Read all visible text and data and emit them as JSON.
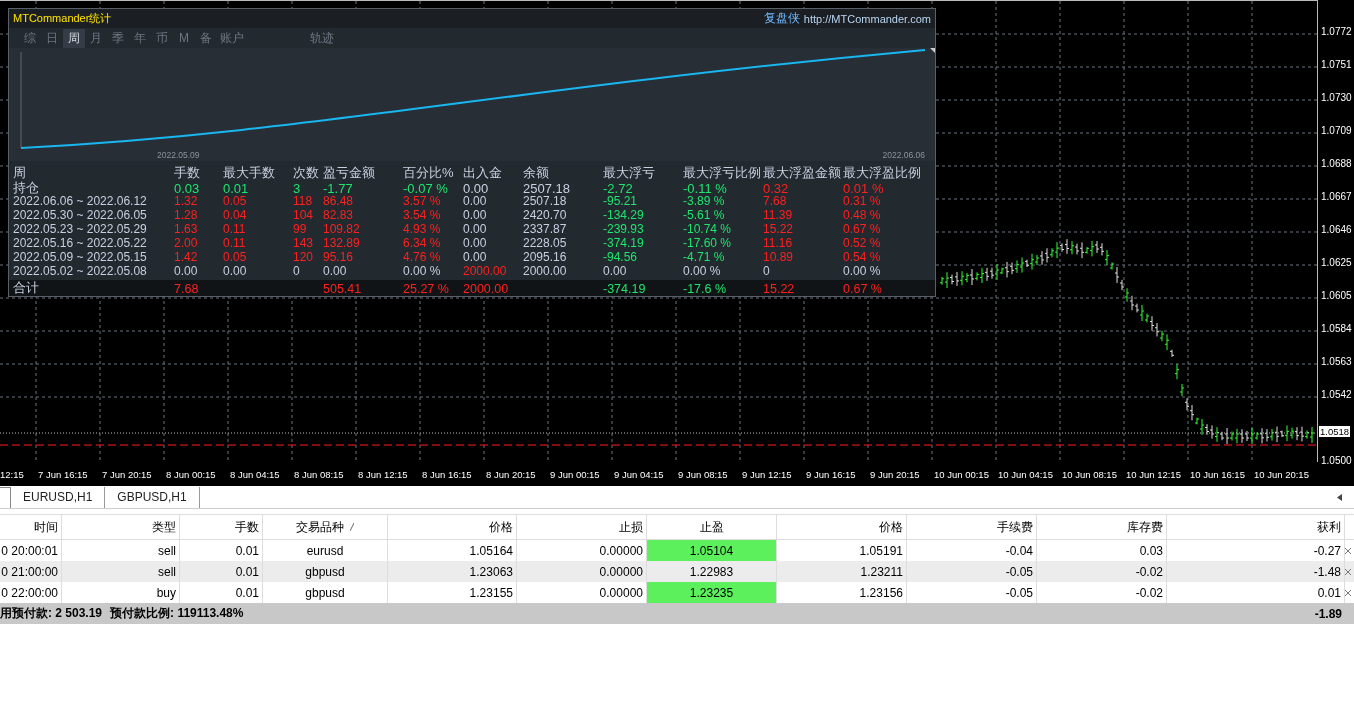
{
  "chart": {
    "price_labels": [
      "1.0772",
      "1.0751",
      "1.0730",
      "1.0709",
      "1.0688",
      "1.0667",
      "1.0646",
      "1.0625",
      "1.0605",
      "1.0584",
      "1.0563",
      "1.0542",
      "1.0500"
    ],
    "current_price": "1.0518",
    "time_labels": [
      "12:15",
      "7 Jun 16:15",
      "7 Jun 20:15",
      "8 Jun 00:15",
      "8 Jun 04:15",
      "8 Jun 08:15",
      "8 Jun 12:15",
      "8 Jun 16:15",
      "8 Jun 20:15",
      "9 Jun 00:15",
      "9 Jun 04:15",
      "9 Jun 08:15",
      "9 Jun 12:15",
      "9 Jun 16:15",
      "9 Jun 20:15",
      "10 Jun 00:15",
      "10 Jun 04:15",
      "10 Jun 08:15",
      "10 Jun 12:15",
      "10 Jun 16:15",
      "10 Jun 20:15"
    ]
  },
  "panel": {
    "title": "MTCommander统计",
    "brand": "复盘侠",
    "link": "http://MTCommander.com",
    "tabs": [
      {
        "label": "综",
        "selected": false
      },
      {
        "label": "日",
        "selected": false
      },
      {
        "label": "周",
        "selected": true
      },
      {
        "label": "月",
        "selected": false
      },
      {
        "label": "季",
        "selected": false
      },
      {
        "label": "年",
        "selected": false
      },
      {
        "label": "币",
        "selected": false
      },
      {
        "label": "M",
        "selected": false
      },
      {
        "label": "备",
        "selected": false
      },
      {
        "label": "账户",
        "selected": false
      },
      {
        "label": "轨迹",
        "selected": false
      }
    ],
    "equity_dates": [
      "2022.05.09",
      "2022.06.06"
    ],
    "columns": [
      "周",
      "手数",
      "最大手数",
      "次数",
      "盈亏金额",
      "百分比%",
      "出入金",
      "余额",
      "最大浮亏",
      "最大浮亏比例",
      "最大浮盈金额",
      "最大浮盈比例"
    ],
    "rows": [
      {
        "kind": "open",
        "cells": [
          {
            "text": "持仓",
            "color": "#c8d0e0"
          },
          {
            "text": "0.03",
            "color": "#1ee66e"
          },
          {
            "text": "0.01",
            "color": "#1ee66e"
          },
          {
            "text": "3",
            "color": "#1ee66e"
          },
          {
            "text": "-1.77",
            "color": "#1ee66e"
          },
          {
            "text": "-0.07 %",
            "color": "#1ee66e"
          },
          {
            "text": "0.00",
            "color": "#c8d0e0"
          },
          {
            "text": "2507.18",
            "color": "#c8d0e0"
          },
          {
            "text": "-2.72",
            "color": "#1ee66e"
          },
          {
            "text": "-0.11 %",
            "color": "#1ee66e"
          },
          {
            "text": "0.32",
            "color": "#ff2020"
          },
          {
            "text": "0.01 %",
            "color": "#ff2020"
          }
        ]
      },
      {
        "kind": "week",
        "cells": [
          {
            "text": "2022.06.06 ~ 2022.06.12",
            "color": "#c8d0e0"
          },
          {
            "text": "1.32",
            "color": "#ff2020"
          },
          {
            "text": "0.05",
            "color": "#ff2020"
          },
          {
            "text": "118",
            "color": "#ff2020"
          },
          {
            "text": "86.48",
            "color": "#ff2020"
          },
          {
            "text": "3.57 %",
            "color": "#ff2020"
          },
          {
            "text": "0.00",
            "color": "#c8d0e0"
          },
          {
            "text": "2507.18",
            "color": "#c8d0e0"
          },
          {
            "text": "-95.21",
            "color": "#1ee66e"
          },
          {
            "text": "-3.89 %",
            "color": "#1ee66e"
          },
          {
            "text": "7.68",
            "color": "#ff2020"
          },
          {
            "text": "0.31 %",
            "color": "#ff2020"
          }
        ]
      },
      {
        "kind": "week",
        "cells": [
          {
            "text": "2022.05.30 ~ 2022.06.05",
            "color": "#c8d0e0"
          },
          {
            "text": "1.28",
            "color": "#ff2020"
          },
          {
            "text": "0.04",
            "color": "#ff2020"
          },
          {
            "text": "104",
            "color": "#ff2020"
          },
          {
            "text": "82.83",
            "color": "#ff2020"
          },
          {
            "text": "3.54 %",
            "color": "#ff2020"
          },
          {
            "text": "0.00",
            "color": "#c8d0e0"
          },
          {
            "text": "2420.70",
            "color": "#c8d0e0"
          },
          {
            "text": "-134.29",
            "color": "#1ee66e"
          },
          {
            "text": "-5.61 %",
            "color": "#1ee66e"
          },
          {
            "text": "11.39",
            "color": "#ff2020"
          },
          {
            "text": "0.48 %",
            "color": "#ff2020"
          }
        ]
      },
      {
        "kind": "week",
        "cells": [
          {
            "text": "2022.05.23 ~ 2022.05.29",
            "color": "#c8d0e0"
          },
          {
            "text": "1.63",
            "color": "#ff2020"
          },
          {
            "text": "0.11",
            "color": "#ff2020"
          },
          {
            "text": "99",
            "color": "#ff2020"
          },
          {
            "text": "109.82",
            "color": "#ff2020"
          },
          {
            "text": "4.93 %",
            "color": "#ff2020"
          },
          {
            "text": "0.00",
            "color": "#c8d0e0"
          },
          {
            "text": "2337.87",
            "color": "#c8d0e0"
          },
          {
            "text": "-239.93",
            "color": "#1ee66e"
          },
          {
            "text": "-10.74 %",
            "color": "#1ee66e"
          },
          {
            "text": "15.22",
            "color": "#ff2020"
          },
          {
            "text": "0.67 %",
            "color": "#ff2020"
          }
        ]
      },
      {
        "kind": "week",
        "cells": [
          {
            "text": "2022.05.16 ~ 2022.05.22",
            "color": "#c8d0e0"
          },
          {
            "text": "2.00",
            "color": "#ff2020"
          },
          {
            "text": "0.11",
            "color": "#ff2020"
          },
          {
            "text": "143",
            "color": "#ff2020"
          },
          {
            "text": "132.89",
            "color": "#ff2020"
          },
          {
            "text": "6.34 %",
            "color": "#ff2020"
          },
          {
            "text": "0.00",
            "color": "#c8d0e0"
          },
          {
            "text": "2228.05",
            "color": "#c8d0e0"
          },
          {
            "text": "-374.19",
            "color": "#1ee66e"
          },
          {
            "text": "-17.60 %",
            "color": "#1ee66e"
          },
          {
            "text": "11.16",
            "color": "#ff2020"
          },
          {
            "text": "0.52 %",
            "color": "#ff2020"
          }
        ]
      },
      {
        "kind": "week",
        "cells": [
          {
            "text": "2022.05.09 ~ 2022.05.15",
            "color": "#c8d0e0"
          },
          {
            "text": "1.42",
            "color": "#ff2020"
          },
          {
            "text": "0.05",
            "color": "#ff2020"
          },
          {
            "text": "120",
            "color": "#ff2020"
          },
          {
            "text": "95.16",
            "color": "#ff2020"
          },
          {
            "text": "4.76 %",
            "color": "#ff2020"
          },
          {
            "text": "0.00",
            "color": "#c8d0e0"
          },
          {
            "text": "2095.16",
            "color": "#c8d0e0"
          },
          {
            "text": "-94.56",
            "color": "#1ee66e"
          },
          {
            "text": "-4.71 %",
            "color": "#1ee66e"
          },
          {
            "text": "10.89",
            "color": "#ff2020"
          },
          {
            "text": "0.54 %",
            "color": "#ff2020"
          }
        ]
      },
      {
        "kind": "week",
        "cells": [
          {
            "text": "2022.05.02 ~ 2022.05.08",
            "color": "#c8d0e0"
          },
          {
            "text": "0.00",
            "color": "#c8d0e0"
          },
          {
            "text": "0.00",
            "color": "#c8d0e0"
          },
          {
            "text": "0",
            "color": "#c8d0e0"
          },
          {
            "text": "0.00",
            "color": "#c8d0e0"
          },
          {
            "text": "0.00 %",
            "color": "#c8d0e0"
          },
          {
            "text": "2000.00",
            "color": "#ff2020"
          },
          {
            "text": "2000.00",
            "color": "#c8d0e0"
          },
          {
            "text": "0.00",
            "color": "#c8d0e0"
          },
          {
            "text": "0.00 %",
            "color": "#c8d0e0"
          },
          {
            "text": "0",
            "color": "#c8d0e0"
          },
          {
            "text": "0.00 %",
            "color": "#c8d0e0"
          }
        ]
      },
      {
        "kind": "total",
        "cells": [
          {
            "text": "合计",
            "color": "#c8d0e0"
          },
          {
            "text": "7.68",
            "color": "#ff2020"
          },
          null,
          null,
          {
            "text": "505.41",
            "color": "#ff2020"
          },
          {
            "text": "25.27 %",
            "color": "#ff2020"
          },
          {
            "text": "2000.00",
            "color": "#ff2020"
          },
          null,
          {
            "text": "-374.19",
            "color": "#1ee66e"
          },
          {
            "text": "-17.6 %",
            "color": "#1ee66e"
          },
          {
            "text": "15.22",
            "color": "#ff2020"
          },
          {
            "text": "0.67 %",
            "color": "#ff2020"
          }
        ]
      }
    ]
  },
  "chart_tabs": [
    {
      "label": "EURUSD,H1",
      "selected": false
    },
    {
      "label": "GBPUSD,H1",
      "selected": false
    }
  ],
  "orders": {
    "columns": [
      "时间",
      "类型",
      "手数",
      "交易品种",
      "价格",
      "止损",
      "止盈",
      "价格",
      "手续费",
      "库存费",
      "获利"
    ],
    "rows": [
      {
        "cells": [
          "0 20:00:01",
          "sell",
          "0.01",
          "eurusd",
          "1.05164",
          "0.00000",
          "1.05104",
          "1.05191",
          "-0.04",
          "0.03",
          "-0.27"
        ],
        "tp_highlight": true
      },
      {
        "cells": [
          "0 21:00:00",
          "sell",
          "0.01",
          "gbpusd",
          "1.23063",
          "0.00000",
          "1.22983",
          "1.23211",
          "-0.05",
          "-0.02",
          "-1.48"
        ],
        "tp_highlight": false
      },
      {
        "cells": [
          "0 22:00:00",
          "buy",
          "0.01",
          "gbpusd",
          "1.23155",
          "0.00000",
          "1.23235",
          "1.23156",
          "-0.05",
          "-0.02",
          "0.01"
        ],
        "tp_highlight": true
      }
    ],
    "summary": {
      "margin": "用预付款: 2 503.19",
      "ratio": "预付款比例: 119113.48%",
      "profit": "-1.89"
    }
  }
}
